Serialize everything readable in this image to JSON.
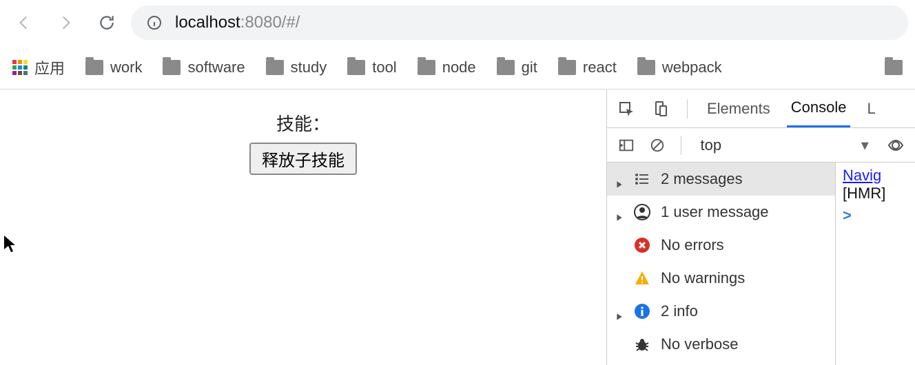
{
  "address": {
    "host": "localhost",
    "rest": ":8080/#/"
  },
  "bookmarks": {
    "apps_label": "应用",
    "folders": [
      "work",
      "software",
      "study",
      "tool",
      "node",
      "git",
      "react",
      "webpack"
    ]
  },
  "page": {
    "skill_label": "技能：",
    "release_button": "释放子技能"
  },
  "devtools": {
    "tabs": {
      "elements": "Elements",
      "console": "Console",
      "next_partial": "L"
    },
    "context_selected": "top",
    "sidebar": {
      "messages": "2 messages",
      "user_messages": "1 user message",
      "errors": "No errors",
      "warnings": "No warnings",
      "info": "2 info",
      "verbose": "No verbose"
    },
    "log": {
      "navigated_partial": "Navig",
      "hmr_partial": "[HMR]"
    }
  },
  "apps_colors": [
    "#e53935",
    "#fb8c00",
    "#fdd835",
    "#43a047",
    "#1e88e5",
    "#00897b",
    "#8e24aa",
    "#6d4c41",
    "#546e7a"
  ]
}
